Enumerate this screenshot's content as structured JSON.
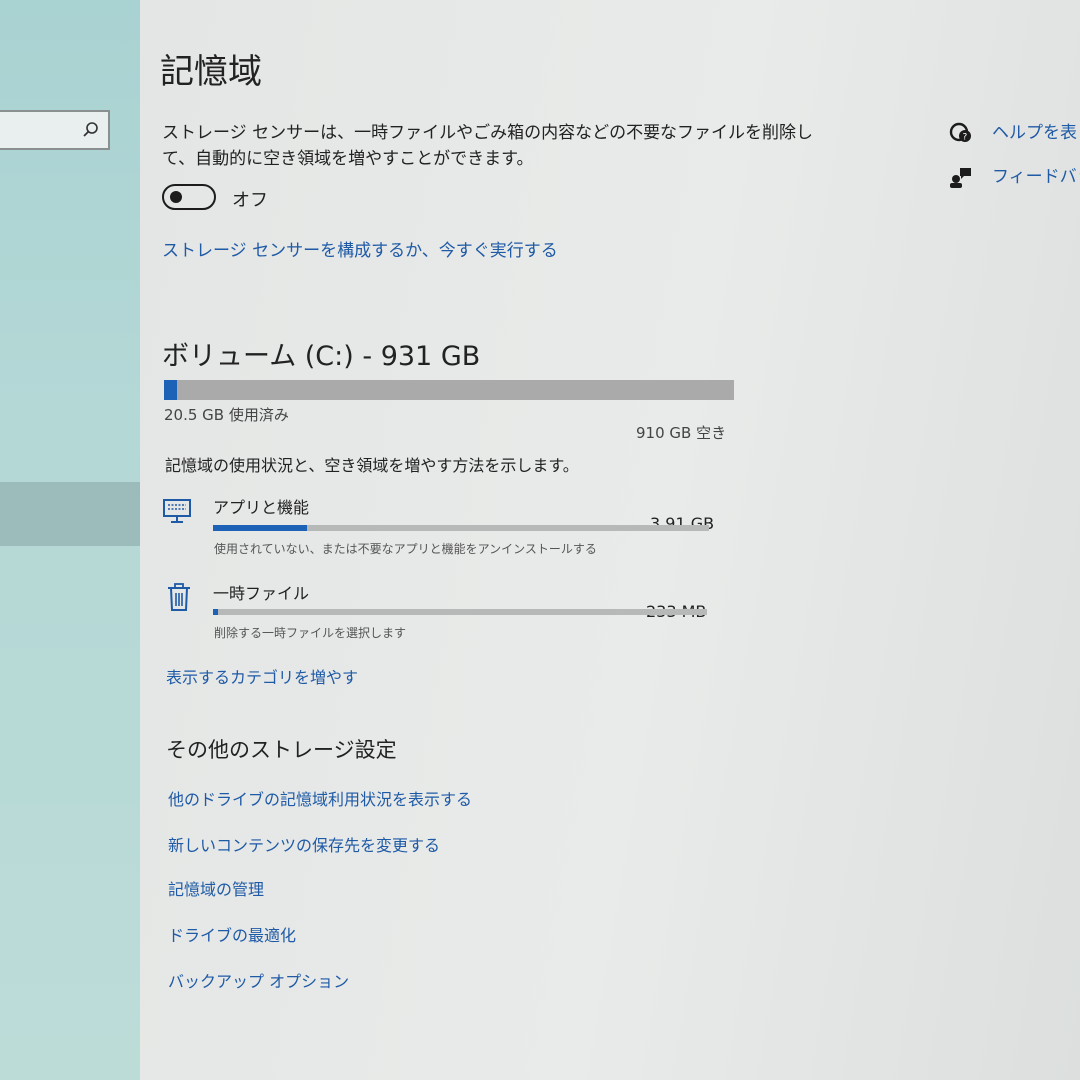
{
  "sidebar": {
    "search_icon": "search-icon"
  },
  "page": {
    "title": "記憶域"
  },
  "storage_sense": {
    "description_line1": "ストレージ センサーは、一時ファイルやごみ箱の内容などの不要なファイルを削除し",
    "description_line2": "て、自動的に空き領域を増やすことができます。",
    "toggle_state": "オフ",
    "toggle_on": false,
    "configure_link": "ストレージ センサーを構成するか、今すぐ実行する"
  },
  "side_links": {
    "help": {
      "label": "ヘルプを表",
      "icon": "help-chat-icon"
    },
    "feedback": {
      "label": "フィードバッ",
      "icon": "feedback-icon"
    }
  },
  "volume": {
    "title": "ボリューム (C:) - 931 GB",
    "used_label": "20.5 GB 使用済み",
    "free_label": "910 GB 空き",
    "used_fraction": 0.022,
    "usage_description": "記憶域の使用状況と、空き領域を増やす方法を示します。"
  },
  "categories": [
    {
      "name": "アプリと機能",
      "size": "3.91 GB",
      "description": "使用されていない、または不要なアプリと機能をアンインストールする",
      "fill_fraction": 0.19,
      "icon": "monitor-icon"
    },
    {
      "name": "一時ファイル",
      "size": "233 MB",
      "description": "削除する一時ファイルを選択します",
      "fill_fraction": 0.01,
      "icon": "trash-icon"
    }
  ],
  "more_categories_link": "表示するカテゴリを増やす",
  "other_settings": {
    "title": "その他のストレージ設定",
    "links": [
      "他のドライブの記憶域利用状況を表示する",
      "新しいコンテンツの保存先を変更する",
      "記憶域の管理",
      "ドライブの最適化",
      "バックアップ オプション"
    ]
  },
  "colors": {
    "accent": "#1c63b7",
    "link": "#1f5aa6",
    "sidebar": "#b4d8d6"
  }
}
